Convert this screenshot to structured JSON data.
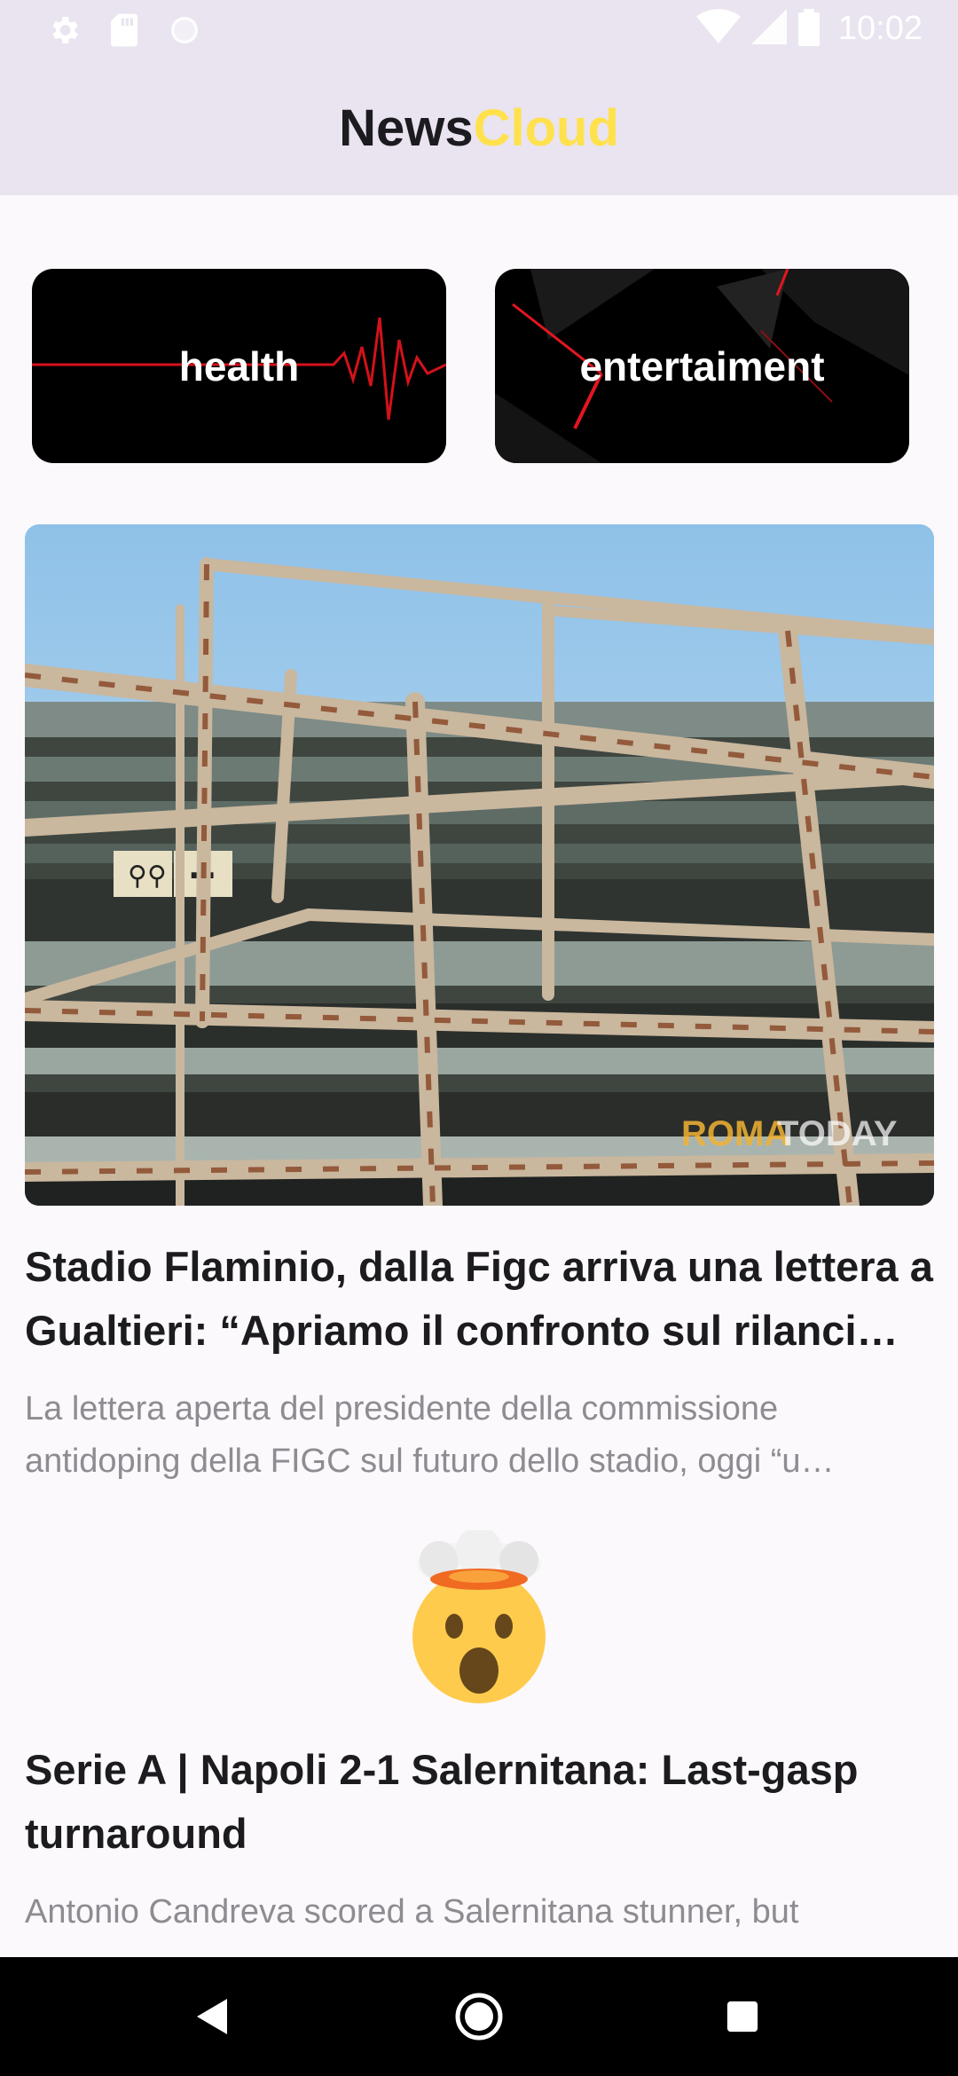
{
  "status_bar": {
    "time": "10:02",
    "left_icons": [
      "settings-icon",
      "sd-card-icon",
      "circle-icon"
    ],
    "right_icons": [
      "wifi-icon",
      "signal-icon",
      "battery-icon"
    ]
  },
  "app_bar": {
    "title_part1": "News",
    "title_part2": "Cloud",
    "title_part1_color": "#1c1b1f",
    "title_part2_color": "#ffe14d"
  },
  "categories": [
    {
      "label": "health"
    },
    {
      "label": "entertaiment"
    }
  ],
  "articles": [
    {
      "image": "stadium-photo",
      "image_watermark_part1": "ROMA",
      "image_watermark_part2": "TODAY",
      "title": "Stadio Flaminio, dalla Figc arriva una lettera a Gualtieri: “Apriamo il confronto sul rilanci…",
      "description": "La lettera aperta del presidente della commissione antidoping della FIGC sul futuro dello stadio, oggi “u…"
    },
    {
      "image": "exploding-head-emoji",
      "title": "Serie A | Napoli 2-1 Salernitana: Last-gasp turnaround",
      "description": "Antonio Candreva scored a Salernitana stunner, but"
    }
  ],
  "nav_bar": {
    "buttons": [
      "back-icon",
      "home-icon",
      "recents-icon"
    ]
  },
  "colors": {
    "app_bar_bg": "#e9e4ef",
    "page_bg": "#fcf9fc",
    "accent_yellow": "#ffe14d",
    "description_gray": "#8e8b92"
  }
}
